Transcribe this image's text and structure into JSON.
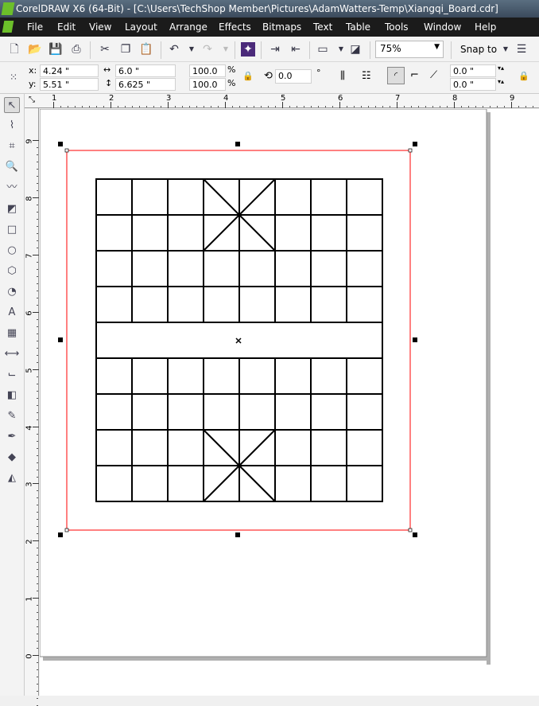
{
  "title": "CorelDRAW X6 (64-Bit) - [C:\\Users\\TechShop Member\\Pictures\\AdamWatters-Temp\\Xiangqi_Board.cdr]",
  "menu": [
    "File",
    "Edit",
    "View",
    "Layout",
    "Arrange",
    "Effects",
    "Bitmaps",
    "Text",
    "Table",
    "Tools",
    "Window",
    "Help"
  ],
  "toolbar": {
    "zoom": "75%",
    "snap": "Snap to"
  },
  "props": {
    "x_label": "x:",
    "x": "4.24 \"",
    "y_label": "y:",
    "y": "5.51 \"",
    "width": "6.0 \"",
    "height": "6.625 \"",
    "scale_x": "100.0",
    "scale_y": "100.0",
    "pct": "%",
    "rotation": "0.0",
    "deg": "°",
    "offset1": "0.0 \"",
    "offset2": "0.0 \""
  },
  "ruler_h": [
    "1",
    "2",
    "3",
    "4",
    "5",
    "6",
    "7",
    "8",
    "9"
  ],
  "ruler_v": [
    "9",
    "8",
    "7",
    "6",
    "5",
    "4",
    "3",
    "2",
    "1",
    "0"
  ],
  "tools": [
    "pick-tool",
    "shape-tool",
    "crop-tool",
    "zoom-tool",
    "freehand-tool",
    "smart-fill-tool",
    "rectangle-tool",
    "ellipse-tool",
    "polygon-tool",
    "basic-shapes-tool",
    "text-tool",
    "table-tool",
    "dimension-tool",
    "connector-tool",
    "blend-tool",
    "eyedropper-tool",
    "outline-pen-tool",
    "fill-tool",
    "interactive-fill-tool"
  ],
  "colors": {
    "selection": "#ff0000",
    "accent": "#6cbf2a"
  }
}
